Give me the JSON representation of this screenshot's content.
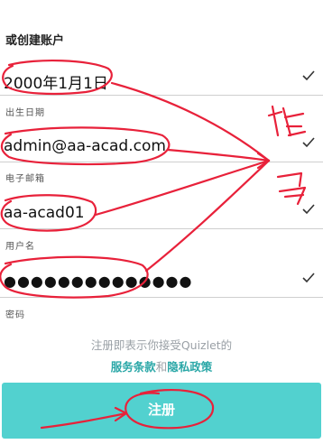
{
  "header": {
    "title": "或创建账户"
  },
  "fields": {
    "birthday": {
      "value": "2000年1月1日",
      "label": "出生日期"
    },
    "email": {
      "value": "admin@aa-acad.com",
      "label": "电子邮箱"
    },
    "username": {
      "value": "aa-acad01",
      "label": "用户名"
    },
    "password": {
      "value": "●●●●●●●●●●●●●●",
      "label": "密码"
    }
  },
  "terms": {
    "text": "注册即表示你接受Quizlet的",
    "service_link": "服务条款",
    "and": "和",
    "privacy_link": "隐私政策"
  },
  "signup_button": {
    "label": "注册"
  },
  "annotation": {
    "handwritten_text": "填写"
  },
  "colors": {
    "accent": "#52d1cf",
    "link": "#2aa7a7",
    "annotation": "#e8213a"
  }
}
